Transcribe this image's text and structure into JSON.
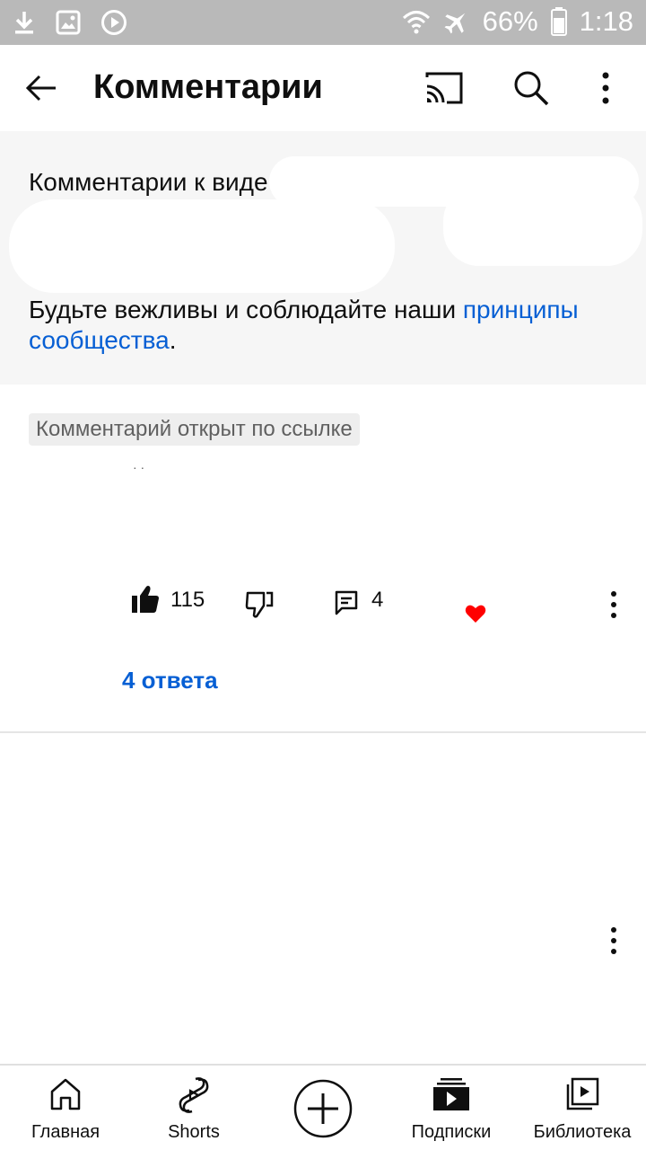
{
  "status_bar": {
    "battery": "66%",
    "time": "1:18"
  },
  "app_bar": {
    "title": "Комментарии"
  },
  "header": {
    "video_title": "Комментарии к виде",
    "guidelines_text": "Будьте вежливы и соблюдайте наши ",
    "guidelines_link": "принципы сообщества",
    "guidelines_end": "."
  },
  "comment": {
    "badge": "Комментарий открыт по ссылке",
    "author_fragment": "·  ·",
    "like_count": "115",
    "reply_count": "4",
    "replies_link": "4 ответа"
  },
  "bottom_nav": {
    "home": "Главная",
    "shorts": "Shorts",
    "subscriptions": "Подписки",
    "library": "Библиотека"
  },
  "colors": {
    "accent_link": "#065fd4",
    "status_bar_bg": "#b9b9b9",
    "panel_bg": "#f6f6f6",
    "heart": "#ff0000"
  }
}
